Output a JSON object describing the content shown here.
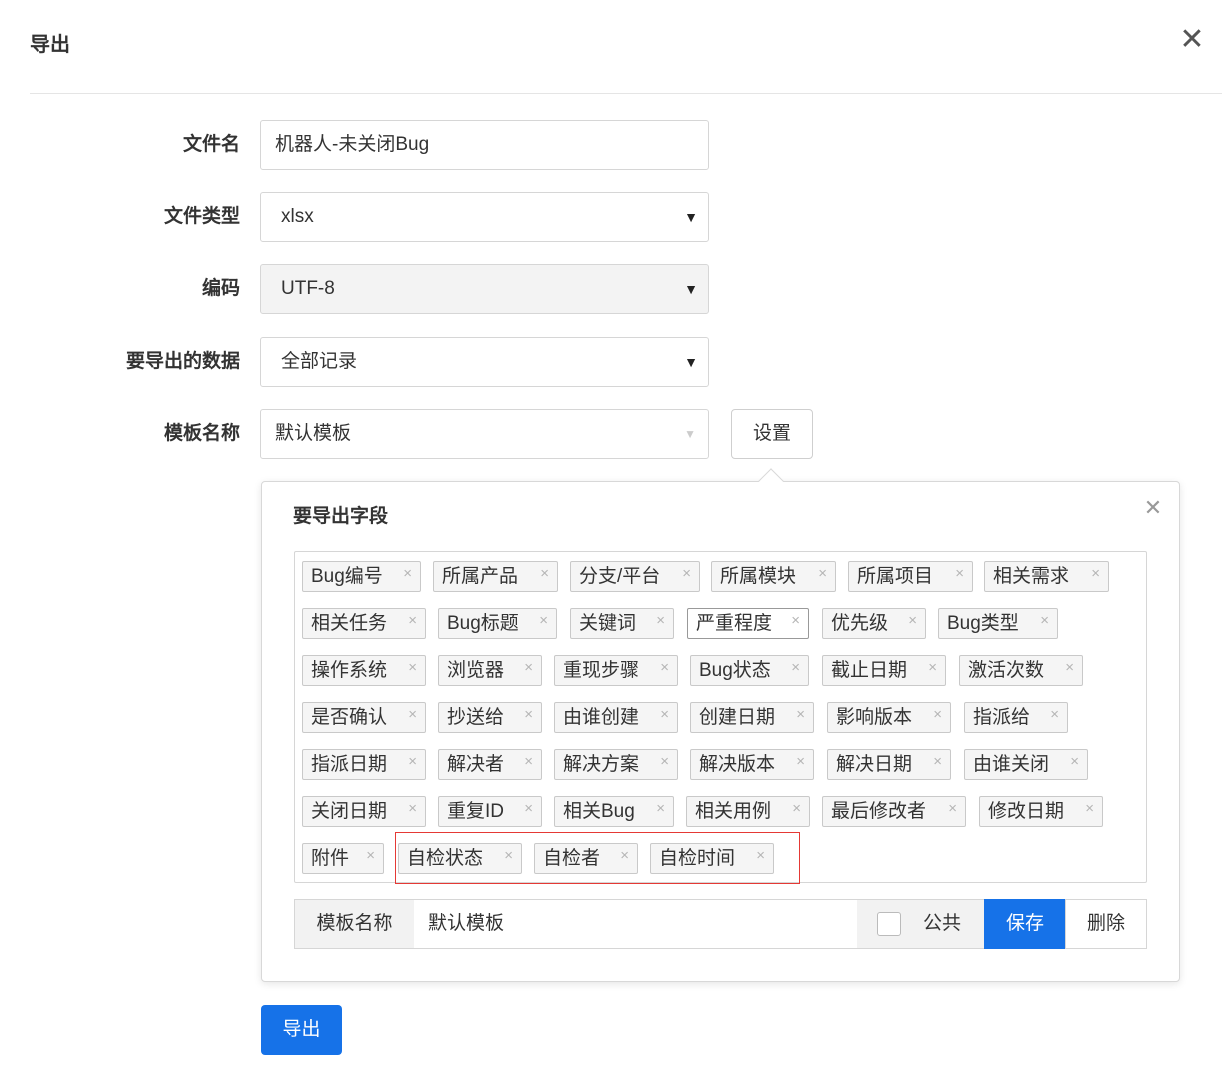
{
  "dialog": {
    "title": "导出",
    "close_icon": "close-icon"
  },
  "form": {
    "filename": {
      "label": "文件名",
      "value": "机器人-未关闭Bug"
    },
    "filetype": {
      "label": "文件类型",
      "value": "xlsx"
    },
    "encoding": {
      "label": "编码",
      "value": "UTF-8"
    },
    "data_scope": {
      "label": "要导出的数据",
      "value": "全部记录"
    },
    "template": {
      "label": "模板名称",
      "value": "默认模板",
      "settings_button": "设置"
    }
  },
  "fields_panel": {
    "title": "要导出字段",
    "rows": [
      [
        "Bug编号",
        "所属产品",
        "分支/平台",
        "所属模块",
        "所属项目",
        "相关需求"
      ],
      [
        "相关任务",
        "Bug标题",
        "关键词",
        "严重程度",
        "优先级",
        "Bug类型"
      ],
      [
        "操作系统",
        "浏览器",
        "重现步骤",
        "Bug状态",
        "截止日期",
        "激活次数"
      ],
      [
        "是否确认",
        "抄送给",
        "由谁创建",
        "创建日期",
        "影响版本",
        "指派给"
      ],
      [
        "指派日期",
        "解决者",
        "解决方案",
        "解决版本",
        "解决日期",
        "由谁关闭"
      ],
      [
        "关闭日期",
        "重复ID",
        "相关Bug",
        "相关用例",
        "最后修改者",
        "修改日期"
      ],
      [
        "附件",
        "自检状态",
        "自检者",
        "自检时间"
      ]
    ],
    "remove_symbol": "×",
    "template_row": {
      "addon_label": "模板名称",
      "value": "默认模板",
      "public_label": "公共",
      "public_checked": false,
      "save_button": "保存",
      "delete_button": "删除"
    }
  },
  "export_button": "导出",
  "colors": {
    "primary": "#1672e8",
    "highlight_box": "#e53935"
  }
}
